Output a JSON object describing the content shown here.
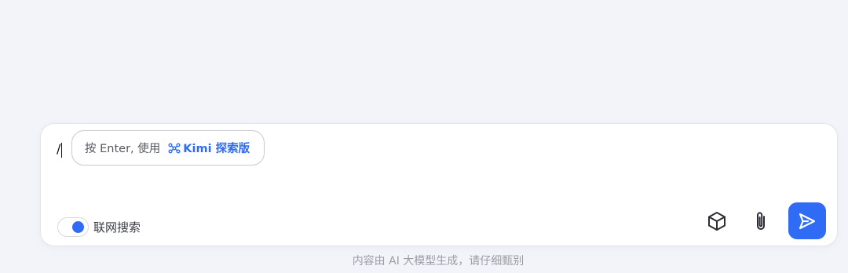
{
  "composer": {
    "input_value": "/",
    "hint": {
      "prefix": "按 Enter, 使用",
      "mode_name": "Kimi 探索版"
    },
    "web_search": {
      "label": "联网搜索",
      "enabled": true
    },
    "icons": {
      "hint": "network-icon",
      "tools": "cube-icon",
      "attach": "paperclip-icon",
      "send": "send-icon"
    }
  },
  "footer": {
    "disclaimer": "内容由 AI 大模型生成，请仔细甄别"
  },
  "colors": {
    "accent": "#2f6bf5",
    "page_background": "#f3f4f9"
  }
}
